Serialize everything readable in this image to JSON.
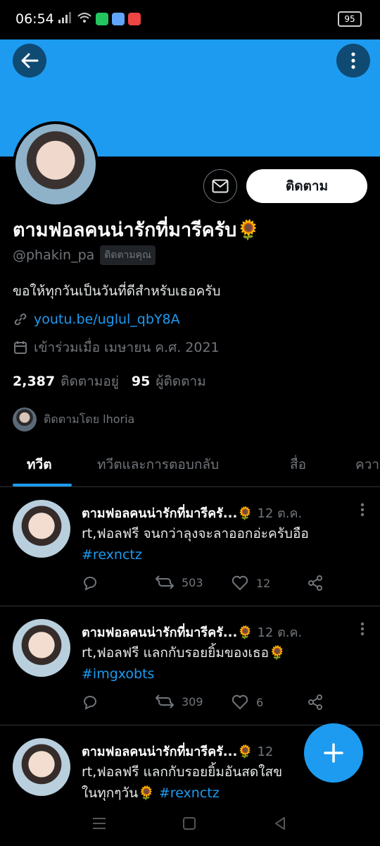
{
  "status_bar": {
    "time": "06:54",
    "battery": "95"
  },
  "profile": {
    "display_name": "ตามฟอลคนน่ารักที่มารีครับ🌻",
    "handle": "@phakin_pa",
    "follows_you": "ติดตามคุณ",
    "bio": "ขอให้ทุกวันเป็นวันที่ดีสำหรับเธอครับ",
    "link": "youtu.be/uglul_qbY8A",
    "joined": "เข้าร่วมเมื่อ เมษายน ค.ศ. 2021",
    "following_count": "2,387",
    "following_label": "ติดตามอยู่",
    "followers_count": "95",
    "followers_label": "ผู้ติดตาม",
    "followed_by": "ติดตามโดย lhoria",
    "follow_button": "ติดตาม"
  },
  "tabs": [
    "ทวีต",
    "ทวีตและการตอบกลับ",
    "สื่อ",
    "ความ"
  ],
  "tweets": [
    {
      "name": "ตามฟอลคนน่ารักที่มารีครั...🌻",
      "date": "12 ต.ค.",
      "text": "rt,ฟอลฟรี จนกว่าลุงจะลาออกอ่ะครับอือ",
      "hashtag": "#rexnctz",
      "retweets": "503",
      "likes": "12"
    },
    {
      "name": "ตามฟอลคนน่ารักที่มารีครั...🌻",
      "date": "12 ต.ค.",
      "text": "rt,ฟอลฟรี แลกกับรอยยิ้มของเธอ🌻",
      "hashtag": "#imgxobts",
      "retweets": "309",
      "likes": "6"
    },
    {
      "name": "ตามฟอลคนน่ารักที่มารีครั...🌻",
      "date": "12",
      "text": "rt,ฟอลฟรี แลกกับรอยยิ้มอันสดใสข",
      "text2": "ในทุกๆวัน🌻",
      "hashtag": "#rexnctz"
    }
  ],
  "colors": {
    "accent": "#1d9bf0",
    "background": "#000000",
    "banner": "#1d9bf0"
  }
}
